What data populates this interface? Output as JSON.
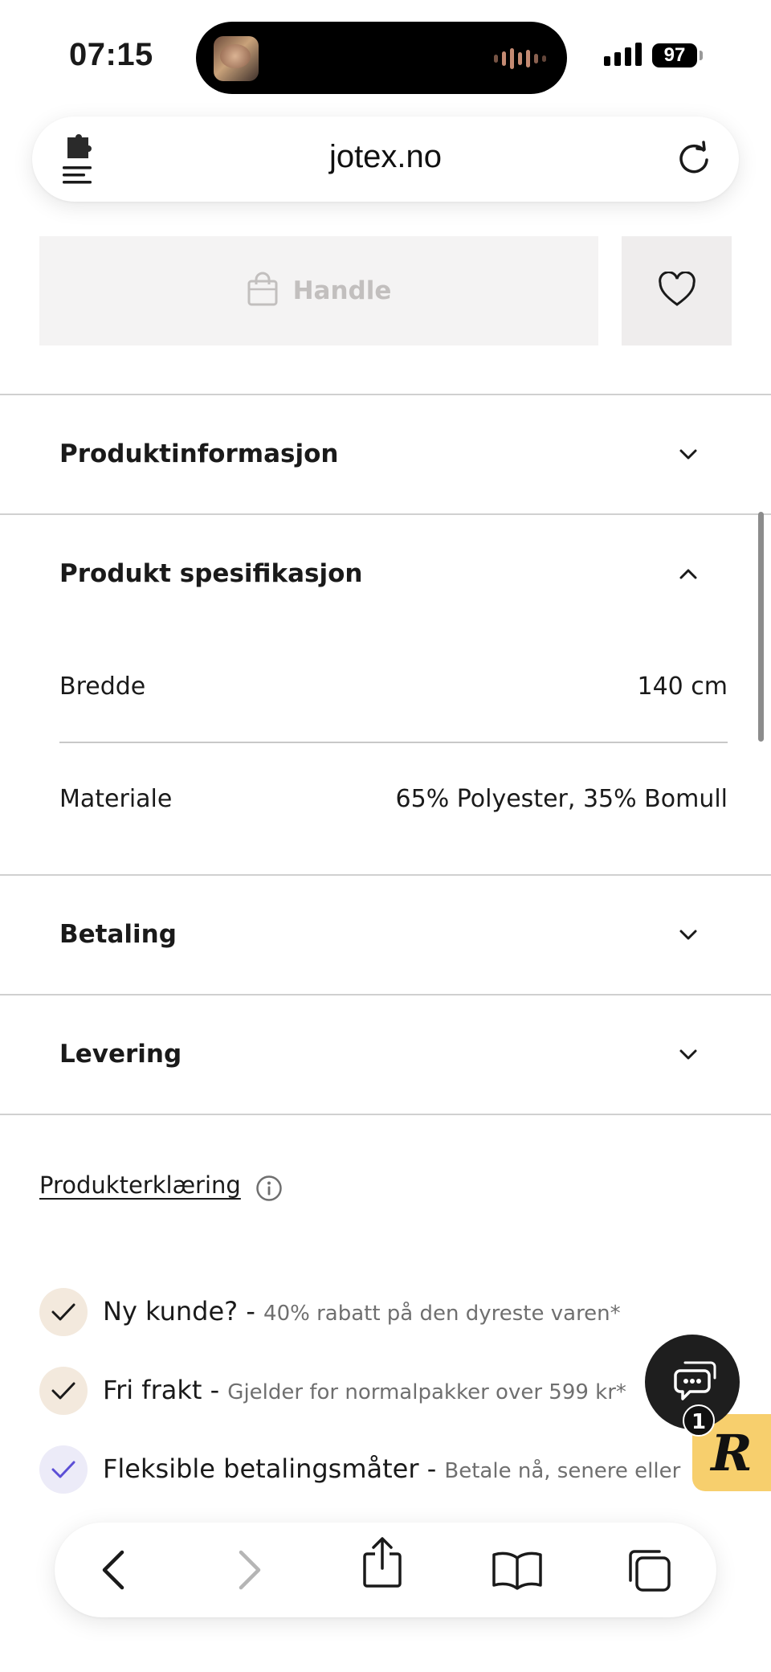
{
  "status_bar": {
    "time": "07:15",
    "battery": "97"
  },
  "browser": {
    "url": "jotex.no"
  },
  "product_actions": {
    "buy_label": "Handle"
  },
  "accordions": {
    "product_info": "Produktinformasjon",
    "product_spec": "Produkt spesifikasjon",
    "payment": "Betaling",
    "delivery": "Levering"
  },
  "specs": [
    {
      "label": "Bredde",
      "value": "140 cm"
    },
    {
      "label": "Materiale",
      "value": "65% Polyester, 35% Bomull"
    }
  ],
  "declaration": {
    "label": "Produkterklæring"
  },
  "benefits": [
    {
      "title": "Ny kunde? - ",
      "desc": "40% rabatt på den dyreste varen*",
      "badge_color": "#f3e9dd",
      "check_color": "#1a1a1a"
    },
    {
      "title": "Fri frakt - ",
      "desc": "Gjelder for normalpakker over 599 kr*",
      "badge_color": "#f3e9dd",
      "check_color": "#1a1a1a"
    },
    {
      "title": "Fleksible betalingsmåter - ",
      "desc": "Betale nå, senere eller",
      "badge_color": "#ecebf8",
      "check_color": "#5c4fd6"
    }
  ],
  "chat": {
    "badge_count": "1"
  },
  "colors": {
    "reviews_tab": "#f7cf6d",
    "chat_button": "#1e1e1e"
  },
  "icons": {
    "extensions": "puzzle-menu-icon",
    "reload": "reload-icon",
    "bag": "shopping-bag-icon",
    "favorite": "heart-icon",
    "back": "chevron-left-icon",
    "forward": "chevron-right-icon",
    "share": "share-icon",
    "bookmarks": "book-icon",
    "tabs": "tabs-icon"
  }
}
